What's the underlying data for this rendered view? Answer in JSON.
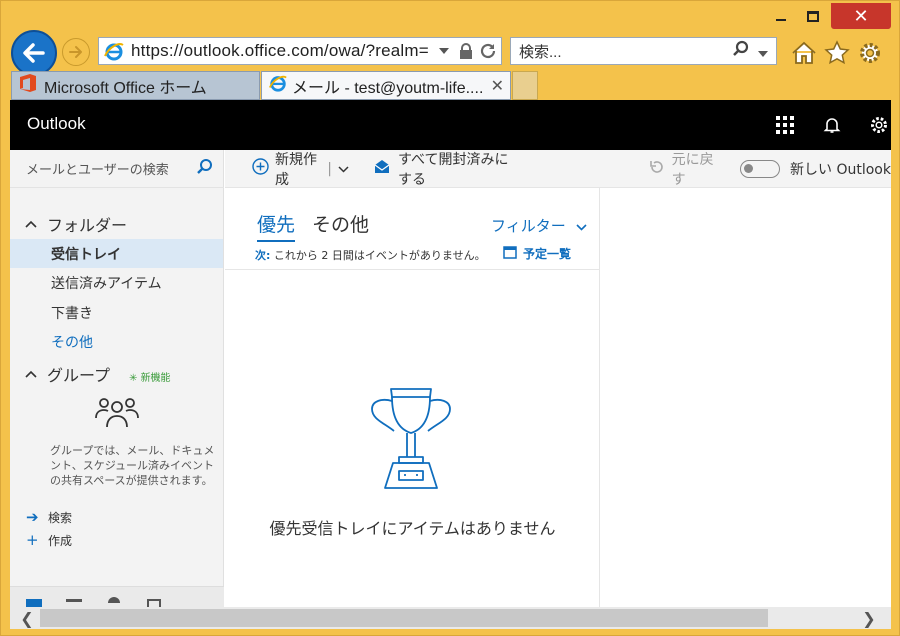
{
  "browser": {
    "address_url": "https://outlook.office.com/owa/?realm=",
    "search_placeholder": "検索...",
    "tabs": [
      {
        "label": "Microsoft Office ホーム"
      },
      {
        "label": "メール - test@youtm-life...."
      }
    ],
    "colors": {
      "frame": "#f4c24b",
      "close": "#c7362b",
      "back": "#1a73c8"
    }
  },
  "app": {
    "title": "Outlook",
    "search_placeholder": "メールとユーザーの検索",
    "folders_header": "フォルダー",
    "folders": [
      {
        "label": "受信トレイ",
        "selected": true
      },
      {
        "label": "送信済みアイテム"
      },
      {
        "label": "下書き"
      },
      {
        "label": "その他",
        "link": true
      }
    ],
    "groups_header": "グループ",
    "groups_new_badge": "新機能",
    "groups_description": "グループでは、メール、ドキュメント、スケジュール済みイベントの共有スペースが提供されます。",
    "actions": [
      {
        "label": "検索",
        "icon": "arrow-right-icon"
      },
      {
        "label": "作成",
        "icon": "plus-icon"
      }
    ],
    "commands": {
      "new": "新規作成",
      "mark_all_read": "すべて開封済みにする",
      "undo": "元に戻す",
      "new_outlook": "新しい Outlook"
    },
    "pivot": {
      "focused": "優先",
      "other": "その他",
      "filter": "フィルター"
    },
    "next_label": "次:",
    "next_text": "これから 2 日間はイベントがありません。",
    "agenda_label": "予定一覧",
    "empty_message": "優先受信トレイにアイテムはありません",
    "accent_color": "#106ebe"
  }
}
